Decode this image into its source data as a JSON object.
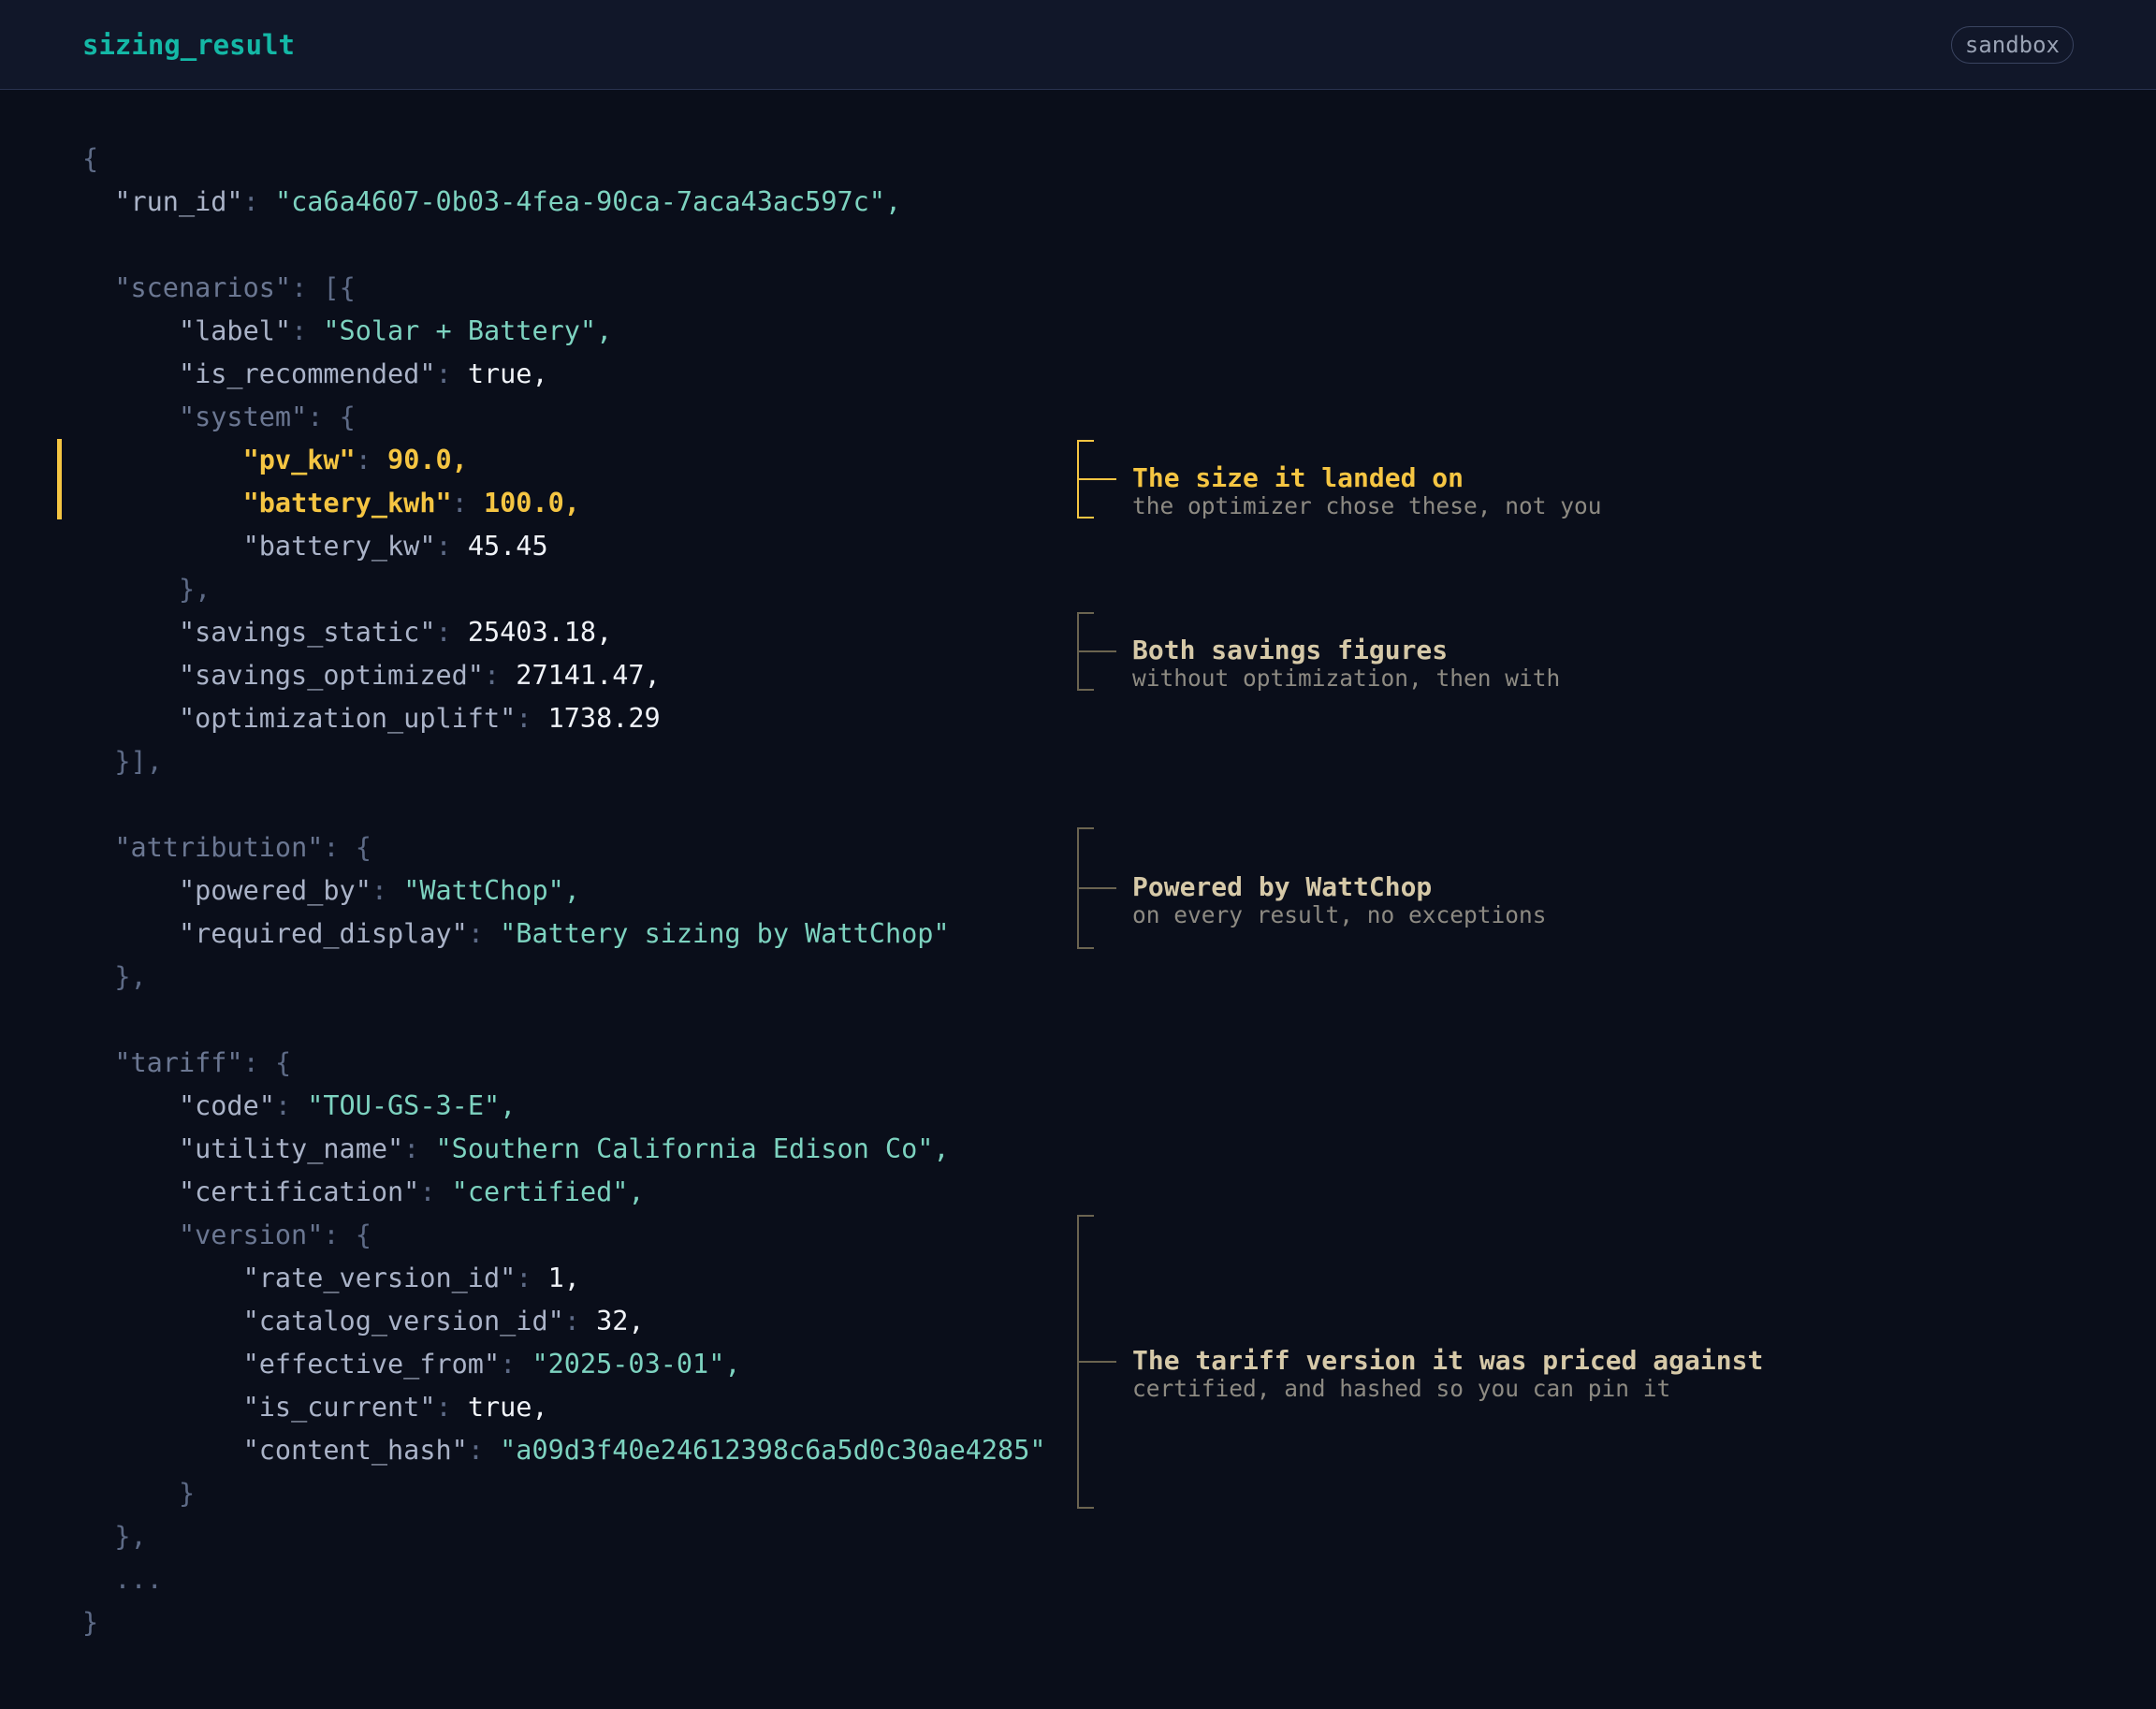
{
  "header": {
    "title": "sizing_result",
    "badge": "sandbox"
  },
  "json": {
    "open_brace": "{",
    "run_id_key": "\"run_id\"",
    "run_id_value": "\"ca6a4607-0b03-4fea-90ca-7aca43ac597c\",",
    "scenarios_key": "\"scenarios\"",
    "scenarios_open": "[{",
    "label_key": "\"label\"",
    "label_value": "\"Solar + Battery\",",
    "is_recommended_key": "\"is_recommended\"",
    "is_recommended_value": "true,",
    "system_key": "\"system\"",
    "system_open": "{",
    "pv_kw_key": "\"pv_kw\"",
    "pv_kw_value": "90.0,",
    "battery_kwh_key": "\"battery_kwh\"",
    "battery_kwh_value": "100.0,",
    "battery_kw_key": "\"battery_kw\"",
    "battery_kw_value": "45.45",
    "system_close": "},",
    "savings_static_key": "\"savings_static\"",
    "savings_static_value": "25403.18,",
    "savings_optimized_key": "\"savings_optimized\"",
    "savings_optimized_value": "27141.47,",
    "optimization_uplift_key": "\"optimization_uplift\"",
    "optimization_uplift_value": "1738.29",
    "scenarios_close": "}],",
    "attribution_key": "\"attribution\"",
    "attribution_open": "{",
    "powered_by_key": "\"powered_by\"",
    "powered_by_value": "\"WattChop\",",
    "required_display_key": "\"required_display\"",
    "required_display_value": "\"Battery sizing by WattChop\"",
    "attribution_close": "},",
    "tariff_key": "\"tariff\"",
    "tariff_open": "{",
    "code_key": "\"code\"",
    "code_value": "\"TOU-GS-3-E\",",
    "utility_name_key": "\"utility_name\"",
    "utility_name_value": "\"Southern California Edison Co\",",
    "certification_key": "\"certification\"",
    "certification_value": "\"certified\",",
    "version_key": "\"version\"",
    "version_open": "{",
    "rate_version_id_key": "\"rate_version_id\"",
    "rate_version_id_value": "1,",
    "catalog_version_id_key": "\"catalog_version_id\"",
    "catalog_version_id_value": "32,",
    "effective_from_key": "\"effective_from\"",
    "effective_from_value": "\"2025-03-01\",",
    "is_current_key": "\"is_current\"",
    "is_current_value": "true,",
    "content_hash_key": "\"content_hash\"",
    "content_hash_value": "\"a09d3f40e24612398c6a5d0c30ae4285\"",
    "version_close": "}",
    "tariff_close": "},",
    "ellipsis": "...",
    "close_brace": "}",
    "colon": ": "
  },
  "annotations": [
    {
      "title": "The size it landed on",
      "subtitle": "the optimizer chose these, not you"
    },
    {
      "title": "Both savings figures",
      "subtitle": "without optimization, then with"
    },
    {
      "title": "Powered by WattChop",
      "subtitle": "on every result, no exceptions"
    },
    {
      "title": "The tariff version it was priced against",
      "subtitle": "certified, and hashed so you can pin it"
    }
  ],
  "colors": {
    "accent": "#14b8a6",
    "highlight": "#f5c542",
    "background": "#0a0e1a"
  }
}
